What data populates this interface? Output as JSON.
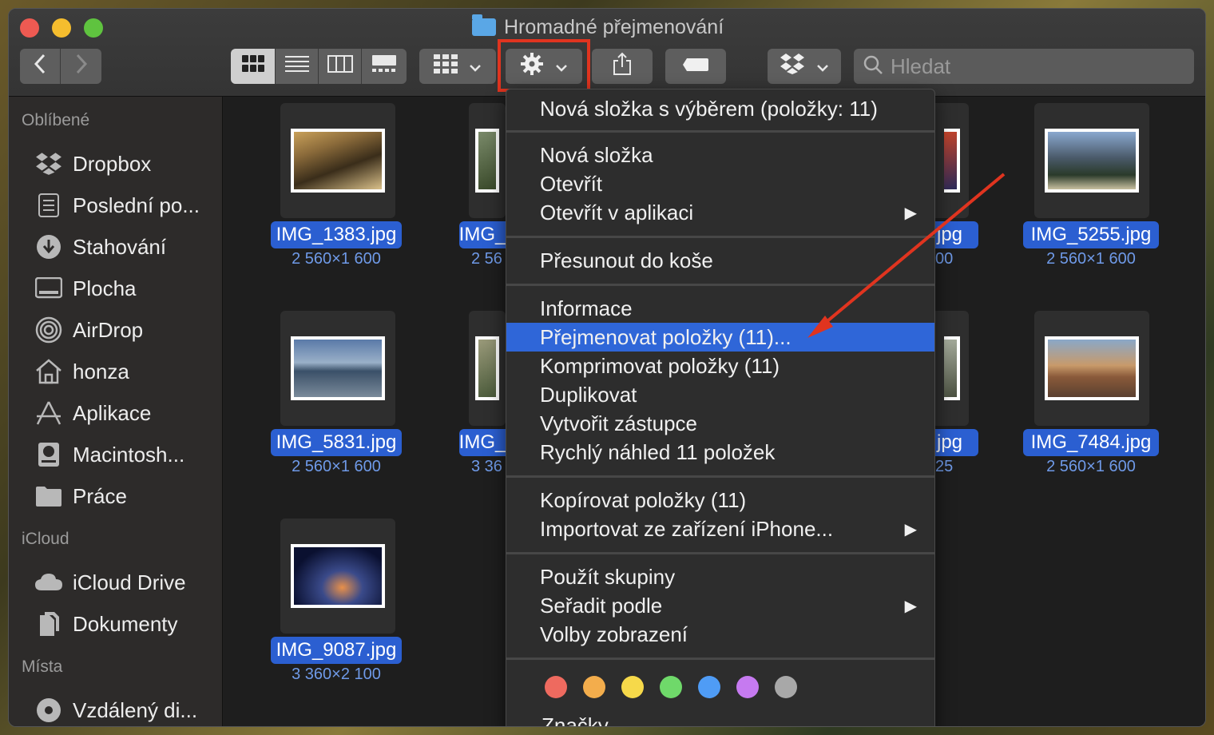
{
  "window": {
    "title": "Hromadné přejmenování"
  },
  "toolbar": {
    "search_placeholder": "Hledat"
  },
  "sidebar": {
    "sections": [
      {
        "label": "Oblíbené"
      },
      {
        "label": "iCloud"
      },
      {
        "label": "Místa"
      }
    ],
    "favorites": [
      {
        "label": "Dropbox",
        "icon": "dropbox-icon"
      },
      {
        "label": "Poslední po...",
        "icon": "recents-icon"
      },
      {
        "label": "Stahování",
        "icon": "downloads-icon"
      },
      {
        "label": "Plocha",
        "icon": "desktop-icon"
      },
      {
        "label": "AirDrop",
        "icon": "airdrop-icon"
      },
      {
        "label": "honza",
        "icon": "home-icon"
      },
      {
        "label": "Aplikace",
        "icon": "applications-icon"
      },
      {
        "label": "Macintosh...",
        "icon": "disk-icon"
      },
      {
        "label": "Práce",
        "icon": "folder-icon"
      }
    ],
    "icloud": [
      {
        "label": "iCloud Drive",
        "icon": "cloud-icon"
      },
      {
        "label": "Dokumenty",
        "icon": "documents-icon"
      }
    ],
    "places": [
      {
        "label": "Vzdálený di...",
        "icon": "remote-disc-icon"
      }
    ]
  },
  "files": [
    {
      "name": "IMG_1383.jpg",
      "dims": "2 560×1 600"
    },
    {
      "name": "IMG_",
      "dims": "2 56"
    },
    {
      "name": "jpg",
      "dims": "00"
    },
    {
      "name": "IMG_5255.jpg",
      "dims": "2 560×1 600"
    },
    {
      "name": "IMG_5831.jpg",
      "dims": "2 560×1 600"
    },
    {
      "name": "IMG_",
      "dims": "3 36"
    },
    {
      "name": "jpg",
      "dims": "25"
    },
    {
      "name": "IMG_7484.jpg",
      "dims": "2 560×1 600"
    },
    {
      "name": "IMG_9087.jpg",
      "dims": "3 360×2 100"
    }
  ],
  "menu": {
    "items": [
      {
        "label": "Nová složka s výběrem (položky: 11)"
      },
      {
        "label": "Nová složka"
      },
      {
        "label": "Otevřít"
      },
      {
        "label": "Otevřít v aplikaci",
        "submenu": "▶"
      },
      {
        "label": "Přesunout do koše"
      },
      {
        "label": "Informace"
      },
      {
        "label": "Přejmenovat položky (11)..."
      },
      {
        "label": "Komprimovat položky (11)"
      },
      {
        "label": "Duplikovat"
      },
      {
        "label": "Vytvořit zástupce"
      },
      {
        "label": "Rychlý náhled 11 položek"
      },
      {
        "label": "Kopírovat položky (11)"
      },
      {
        "label": "Importovat ze zařízení iPhone...",
        "submenu": "▶"
      },
      {
        "label": "Použít skupiny"
      },
      {
        "label": "Seřadit podle",
        "submenu": "▶"
      },
      {
        "label": "Volby zobrazení"
      },
      {
        "label": "Značky..."
      }
    ],
    "selected_index": 6,
    "tag_colors": [
      "#ee6a5f",
      "#f3ad4c",
      "#f6d94a",
      "#6fd96a",
      "#4f9cf5",
      "#c67af0",
      "#a8a8a8"
    ]
  },
  "colors": {
    "accent": "#2f66d8",
    "annotation": "#e0341f"
  }
}
